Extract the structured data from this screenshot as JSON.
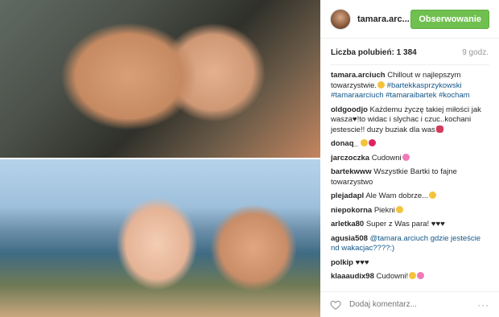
{
  "header": {
    "username": "tamara.arc...",
    "follow_label": "Obserwowanie"
  },
  "likes": {
    "text": "Liczba polubień: 1 384",
    "time": "9 godz."
  },
  "caption": {
    "user": "tamara.arciuch",
    "text": "Chillout w najlepszym towarzystwie.",
    "tags": "#bartekkasprzykowski #tamaraarciuch #tamaraibartek #kocham"
  },
  "comments": [
    {
      "user": "oldgoodjo",
      "text": "Każdemu życzę takiej miłości jak wasza♥!to widac i slychac i czuc..kochani jestescie!! duzy buziak dla was"
    },
    {
      "user": "donaq_",
      "text": ""
    },
    {
      "user": "jarczoczka",
      "text": "Cudowni"
    },
    {
      "user": "bartekwww",
      "text": "Wszystkie Bartki to fajne towarzystwo"
    },
    {
      "user": "plejadapl",
      "text": "Ale Wam dobrze..."
    },
    {
      "user": "niepokorna",
      "text": "Piekni"
    },
    {
      "user": "arletka80",
      "text": "Super z Was para! ♥♥♥"
    },
    {
      "user": "agusia508",
      "text": "@tamara.arciuch gdzie jesteście nd wakacjac????:)"
    },
    {
      "user": "polkip",
      "text": "♥♥♥"
    },
    {
      "user": "klaaaudix98",
      "text": "Cudowni!"
    }
  ],
  "footer": {
    "placeholder": "Dodaj komentarz...",
    "more": "···"
  },
  "colors": {
    "follow_bg": "#70c050",
    "hashtag": "#125688"
  }
}
